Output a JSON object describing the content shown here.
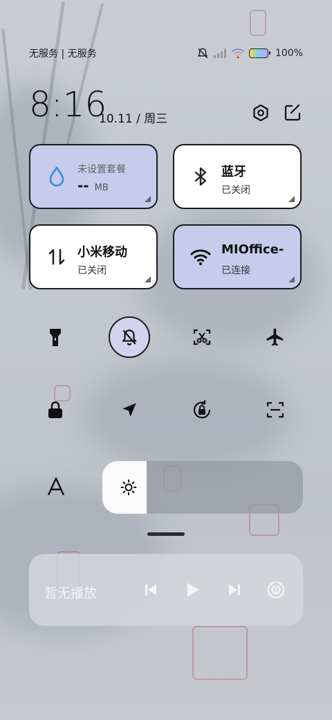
{
  "status_bar": {
    "carrier_text": "无服务 | 无服务",
    "battery_percent": "100%"
  },
  "header": {
    "time": "8:16",
    "date": "10.11 / 周三",
    "settings_icon": "hexagon-settings-icon",
    "edit_icon": "edit-icon"
  },
  "tiles": [
    {
      "title": "未设置套餐",
      "value": "--",
      "unit": "MB",
      "icon": "water-drop-icon",
      "active": true
    },
    {
      "title": "蓝牙",
      "sub": "已关闭",
      "icon": "bluetooth-icon",
      "active": false
    },
    {
      "title": "小米移动",
      "sub": "已关闭",
      "icon": "mobile-data-icon",
      "active": false
    },
    {
      "title": "MIOffice-",
      "sub": "已连接",
      "icon": "wifi-icon",
      "active": true
    }
  ],
  "toggles_row1": [
    {
      "icon": "flashlight-icon",
      "active": false
    },
    {
      "icon": "silent-bell-icon",
      "active": true
    },
    {
      "icon": "screenshot-icon",
      "active": false
    },
    {
      "icon": "airplane-icon",
      "active": false
    }
  ],
  "toggles_row2": [
    {
      "icon": "lock-icon",
      "active": false
    },
    {
      "icon": "location-icon",
      "active": false
    },
    {
      "icon": "rotation-lock-icon",
      "active": false
    },
    {
      "icon": "scan-icon",
      "active": false
    }
  ],
  "brightness": {
    "level": 0.22,
    "font_icon": "A"
  },
  "media": {
    "now_playing": "暂无播放",
    "controls": [
      "previous-icon",
      "play-icon",
      "next-icon",
      "cast-icon"
    ]
  },
  "colors": {
    "active_tile": "#c8cbeb",
    "inactive_tile": "#ffffff",
    "accent_blue": "#2f8fe8"
  }
}
